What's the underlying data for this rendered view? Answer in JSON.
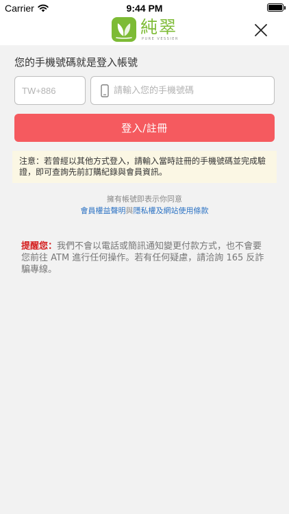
{
  "status_bar": {
    "carrier": "Carrier",
    "time": "9:44 PM",
    "battery_level": 1.0
  },
  "header": {
    "logo_text": "純翠",
    "logo_subtext": "PURE VESSIER",
    "logo_color": "#7dbb35",
    "close_icon": "close-icon"
  },
  "login": {
    "prompt": "您的手機號碼就是登入帳號",
    "country_code_placeholder": "TW+886",
    "phone_placeholder": "請輸入您的手機號碼",
    "phone_icon": "mobile-phone-icon",
    "submit_label": "登入/註冊",
    "submit_color": "#f55a5f"
  },
  "notice": {
    "text": "注意：若曾經以其他方式登入，請輸入當時註冊的手機號碼並完成驗證，即可查詢先前訂購紀錄與會員資訊。",
    "background": "#fbf7e4"
  },
  "agreement": {
    "intro": "擁有帳號即表示你同意",
    "member_terms_link": "會員權益聲明",
    "connector": "與",
    "privacy_link": "隱私權及網站使用條款",
    "link_color": "#2d73c4"
  },
  "warning": {
    "label": "提醒您：",
    "text": "我們不會以電話或簡訊通知變更付款方式，也不會要您前往 ATM 進行任何操作。若有任何疑慮，請洽詢 165 反詐騙專線。",
    "label_color": "#d41d1d"
  }
}
